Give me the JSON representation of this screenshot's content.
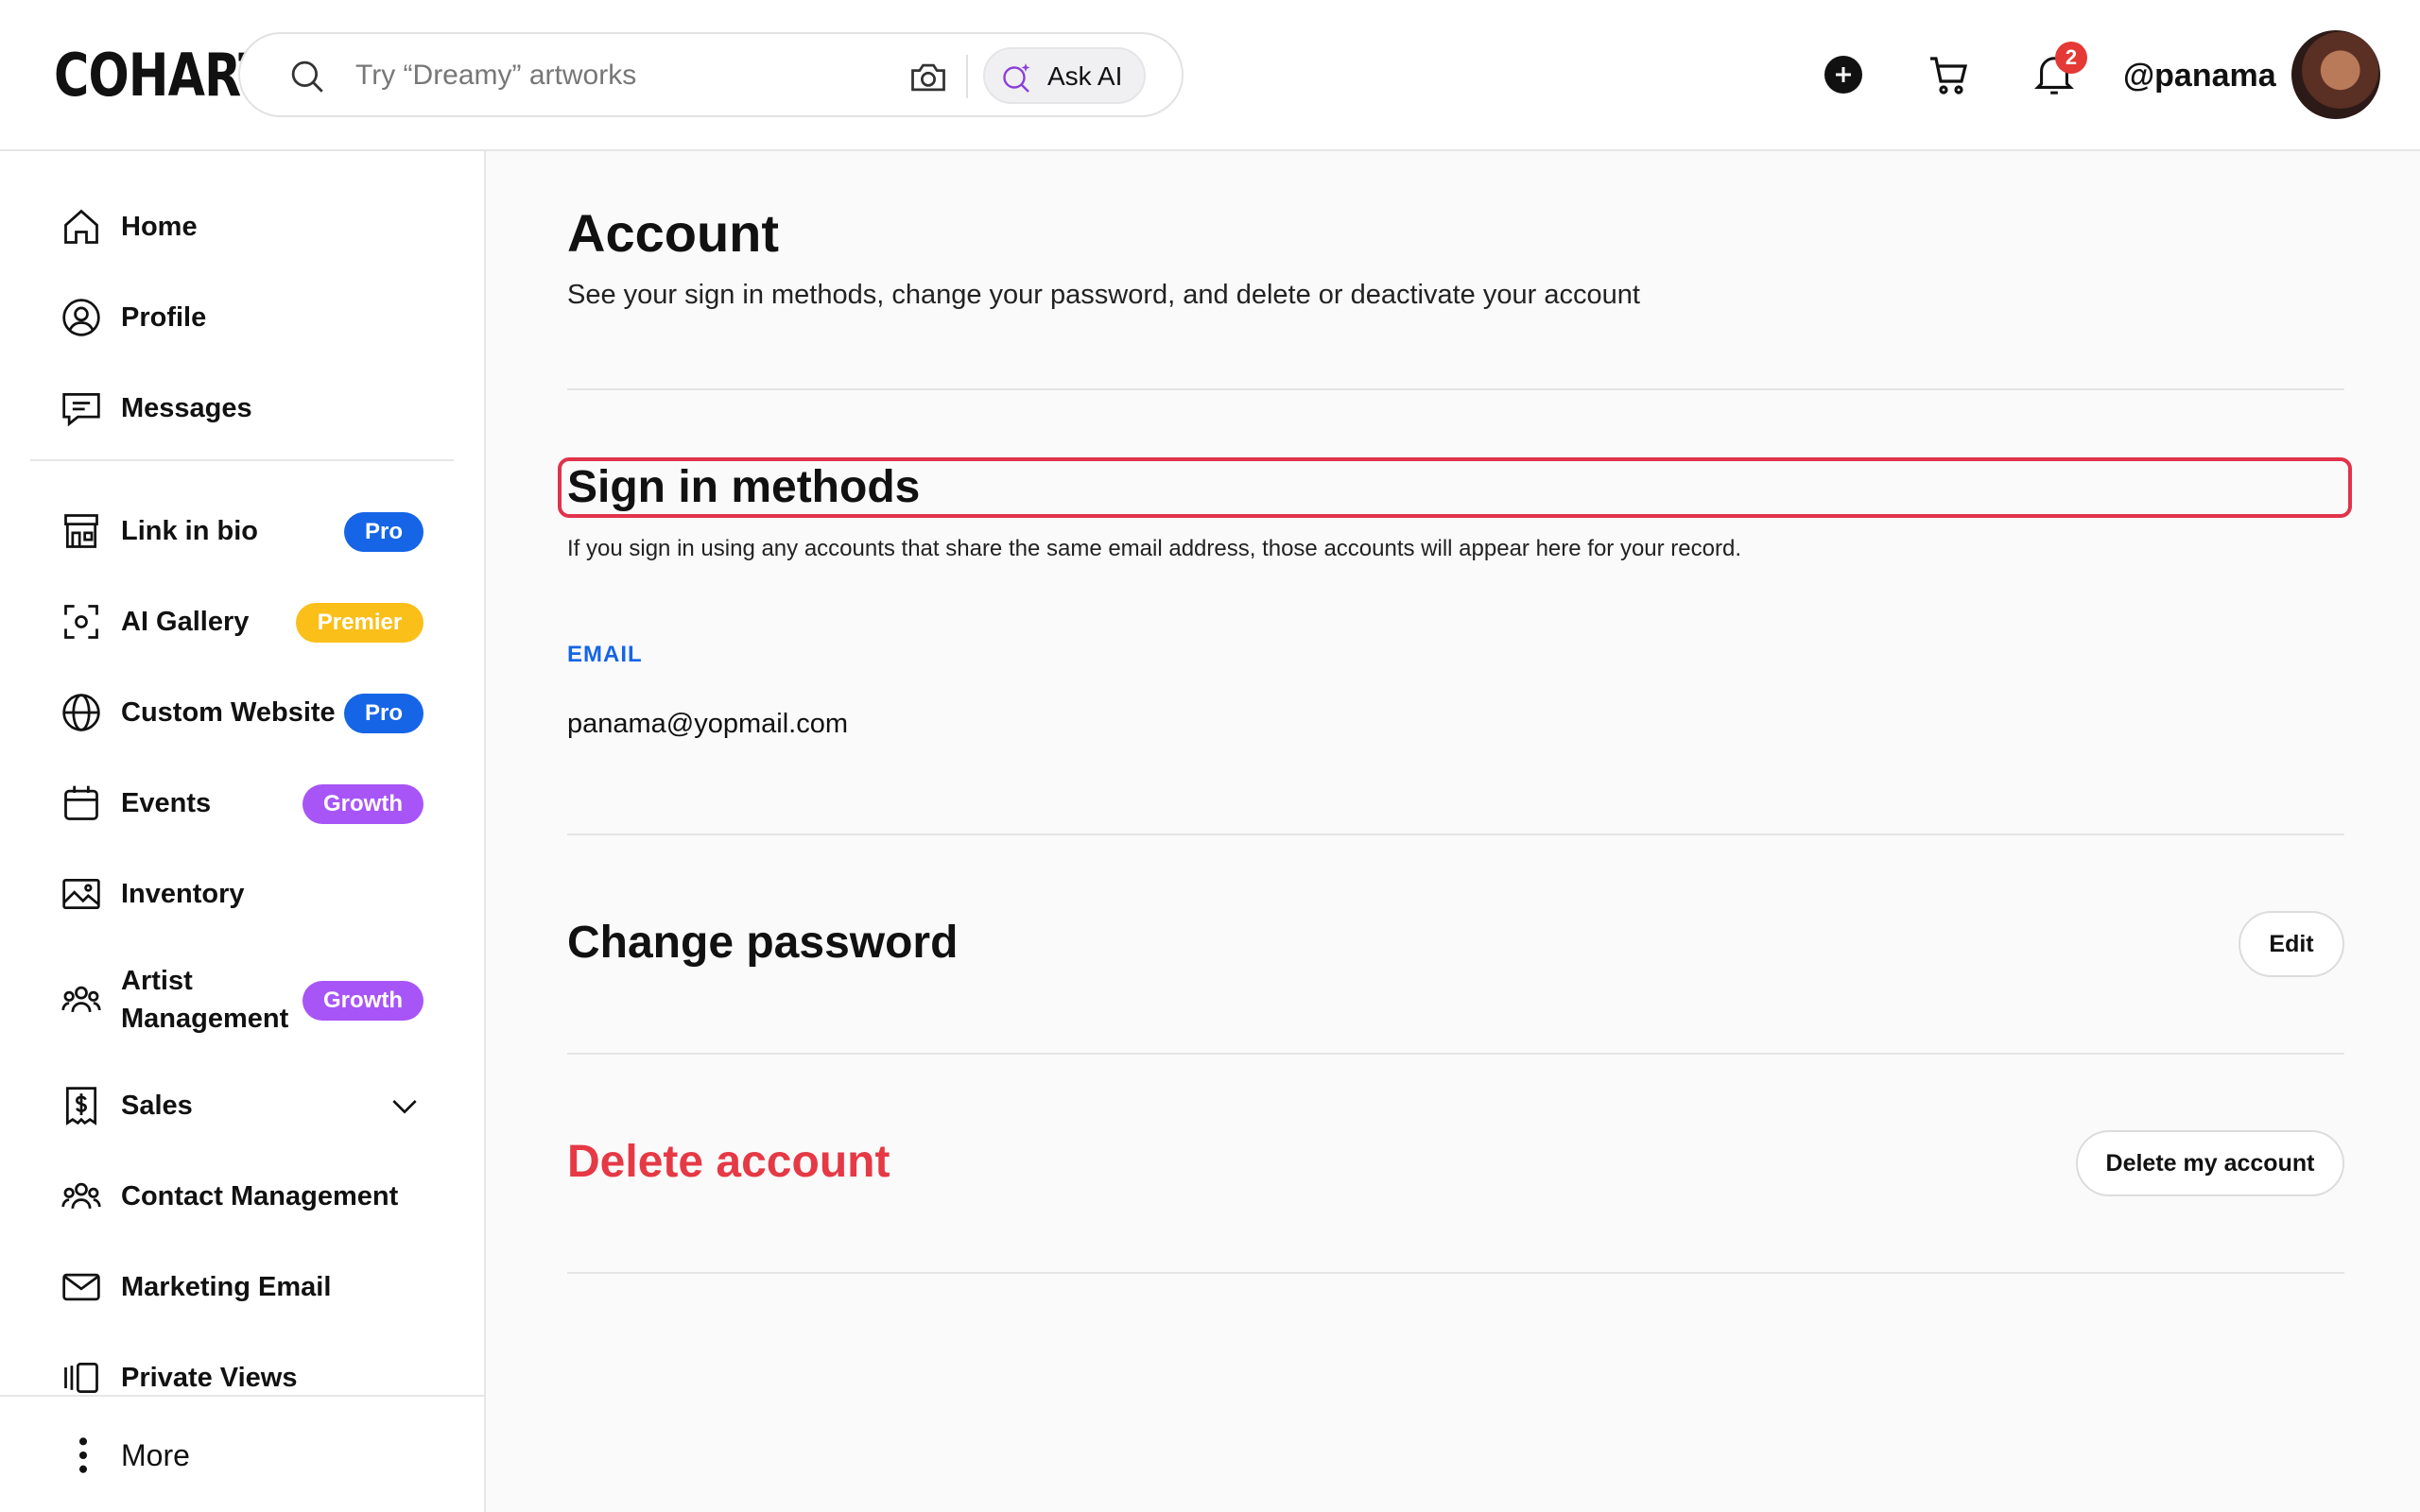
{
  "header": {
    "logo": "COHART",
    "search_placeholder": "Try “Dreamy” artworks",
    "ask_ai_label": "Ask AI",
    "notification_count": "2",
    "username": "@panama"
  },
  "sidebar": {
    "items": [
      {
        "label": "Home",
        "icon": "home-icon"
      },
      {
        "label": "Profile",
        "icon": "profile-icon"
      },
      {
        "label": "Messages",
        "icon": "messages-icon"
      },
      {
        "label": "Link in bio",
        "icon": "storefront-icon",
        "badge": "Pro"
      },
      {
        "label": "AI Gallery",
        "icon": "ai-scan-icon",
        "badge": "Premier"
      },
      {
        "label": "Custom Website",
        "icon": "globe-icon",
        "badge": "Pro"
      },
      {
        "label": "Events",
        "icon": "calendar-icon",
        "badge": "Growth"
      },
      {
        "label": "Inventory",
        "icon": "image-icon"
      },
      {
        "label_line1": "Artist",
        "label_line2": "Management",
        "icon": "people-icon",
        "badge": "Growth"
      },
      {
        "label": "Sales",
        "icon": "dollar-doc-icon"
      },
      {
        "label": "Contact Management",
        "icon": "contacts-icon"
      },
      {
        "label": "Marketing Email",
        "icon": "mail-icon"
      },
      {
        "label": "Private Views",
        "icon": "private-views-icon"
      }
    ],
    "more_label": "More"
  },
  "main": {
    "title": "Account",
    "subtitle": "See your sign in methods, change your password, and delete or deactivate your account",
    "sign_in": {
      "title": "Sign in methods",
      "description": "If you sign in using any accounts that share the same email address, those accounts will appear here for your record.",
      "email_label": "EMAIL",
      "email_value": "panama@yopmail.com"
    },
    "change_password": {
      "title": "Change password",
      "button": "Edit"
    },
    "delete_account": {
      "title": "Delete account",
      "button": "Delete my account"
    }
  },
  "colors": {
    "pro": "#1565e6",
    "premier": "#fbbf1a",
    "growth": "#a855f7",
    "danger": "#e53945",
    "highlight": "#e0334a"
  }
}
